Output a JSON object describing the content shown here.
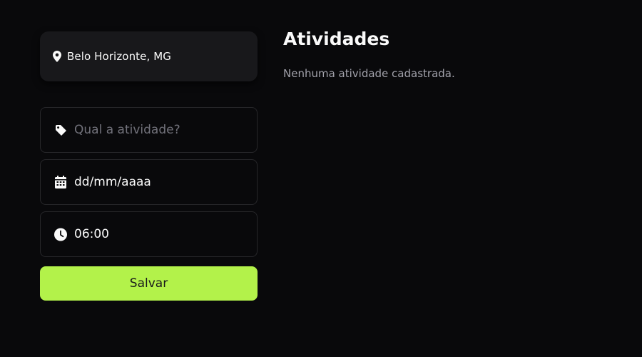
{
  "location": {
    "text": "Belo Horizonte, MG",
    "icon": "map-pin-icon"
  },
  "form": {
    "activity": {
      "placeholder": "Qual a atividade?",
      "value": "",
      "icon": "tag-icon"
    },
    "date": {
      "value": "dd/mm/aaaa",
      "icon": "calendar-icon"
    },
    "time": {
      "value": "06:00",
      "icon": "clock-icon"
    },
    "save_label": "Salvar"
  },
  "activities": {
    "title": "Atividades",
    "empty_message": "Nenhuma atividade cadastrada."
  },
  "colors": {
    "background": "#09090b",
    "card": "#18181b",
    "border": "#27272a",
    "accent": "#b3f24a",
    "muted_text": "#a1a1aa",
    "placeholder": "#71717a"
  }
}
